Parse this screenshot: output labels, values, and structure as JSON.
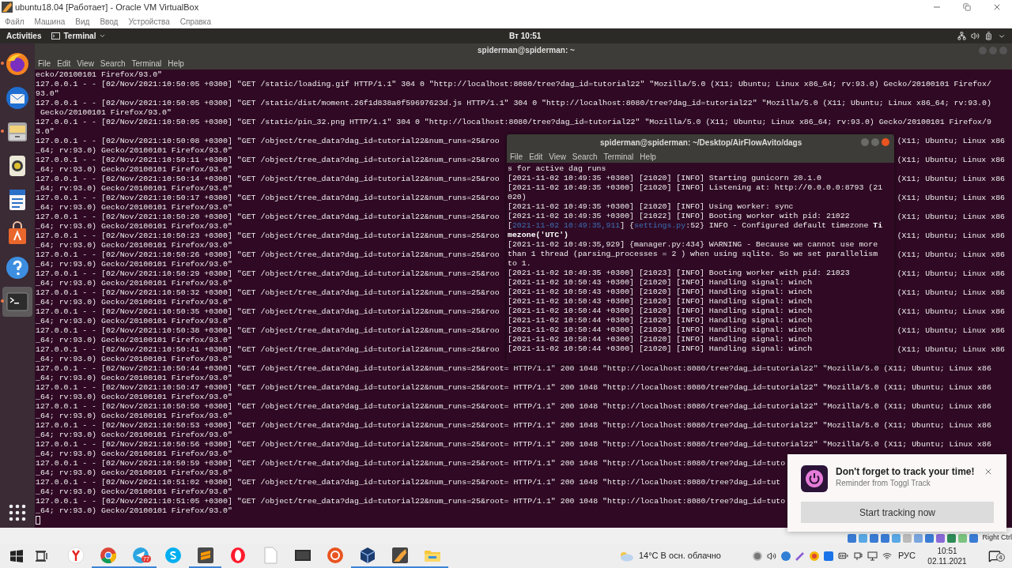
{
  "vbox_window": {
    "title": "ubuntu18.04 [Работает] - Oracle VM VirtualBox",
    "menu": [
      "Файл",
      "Машина",
      "Вид",
      "Ввод",
      "Устройства",
      "Справка"
    ]
  },
  "top_bar": {
    "activities": "Activities",
    "app_menu": "Terminal",
    "clock": "Вт 10:51"
  },
  "dock": [
    {
      "running": true,
      "selected": false
    },
    {
      "running": false,
      "selected": false
    },
    {
      "running": true,
      "selected": false
    },
    {
      "running": false,
      "selected": false
    },
    {
      "running": false,
      "selected": false
    },
    {
      "running": false,
      "selected": false
    },
    {
      "running": false,
      "selected": false
    },
    {
      "running": true,
      "selected": true
    }
  ],
  "main_terminal": {
    "title": "spiderman@spiderman: ~",
    "menu": [
      "File",
      "Edit",
      "View",
      "Search",
      "Terminal",
      "Help"
    ],
    "lines": [
      {
        "text": "ecko/20100101 Firefox/93.0\""
      },
      {
        "text": "127.0.0.1 - - [02/Nov/2021:10:50:05 +0300] \"GET /static/loading.gif HTTP/1.1\" 304 0 \"http://localhost:8080/tree?dag_id=tutorial22\" \"Mozilla/5.0 (X11; Ubuntu; Linux x86_64; rv:93.0) Gecko/20100101 Firefox/"
      },
      {
        "text": "93.0\""
      },
      {
        "text": "127.0.0.1 - - [02/Nov/2021:10:50:05 +0300] \"GET /static/dist/moment.26f1d838a0f59697623d.js HTTP/1.1\" 304 0 \"http://localhost:8080/tree?dag_id=tutorial22\" \"Mozilla/5.0 (X11; Ubuntu; Linux x86_64; rv:93.0)"
      },
      {
        "text": " Gecko/20100101 Firefox/93.0\""
      },
      {
        "text": "127.0.0.1 - - [02/Nov/2021:10:50:05 +0300] \"GET /static/pin_32.png HTTP/1.1\" 304 0 \"http://localhost:8080/tree?dag_id=tutorial22\" \"Mozilla/5.0 (X11; Ubuntu; Linux x86_64; rv:93.0) Gecko/20100101 Firefox/9"
      },
      {
        "text": "3.0\""
      },
      {
        "text": "127.0.0.1 - - [02/Nov/2021:10:50:08 +0300] \"GET /object/tree_data?dag_id=tutorial22&num_runs=25&roo",
        "text_right": "(X11; Ubuntu; Linux x86"
      },
      {
        "text": "_64; rv:93.0) Gecko/20100101 Firefox/93.0\""
      },
      {
        "text": "127.0.0.1 - - [02/Nov/2021:10:50:11 +0300] \"GET /object/tree_data?dag_id=tutorial22&num_runs=25&roo",
        "text_right": "(X11; Ubuntu; Linux x86"
      },
      {
        "text": "_64; rv:93.0) Gecko/20100101 Firefox/93.0\""
      },
      {
        "text": "127.0.0.1 - - [02/Nov/2021:10:50:14 +0300] \"GET /object/tree_data?dag_id=tutorial22&num_runs=25&roo",
        "text_right": "(X11; Ubuntu; Linux x86"
      },
      {
        "text": "_64; rv:93.0) Gecko/20100101 Firefox/93.0\""
      },
      {
        "text": "127.0.0.1 - - [02/Nov/2021:10:50:17 +0300] \"GET /object/tree_data?dag_id=tutorial22&num_runs=25&roo",
        "text_right": "(X11; Ubuntu; Linux x86"
      },
      {
        "text": "_64; rv:93.0) Gecko/20100101 Firefox/93.0\""
      },
      {
        "text": "127.0.0.1 - - [02/Nov/2021:10:50:20 +0300] \"GET /object/tree_data?dag_id=tutorial22&num_runs=25&roo",
        "text_right": "(X11; Ubuntu; Linux x86"
      },
      {
        "text": "_64; rv:93.0) Gecko/20100101 Firefox/93.0\""
      },
      {
        "text": "127.0.0.1 - - [02/Nov/2021:10:50:23 +0300] \"GET /object/tree_data?dag_id=tutorial22&num_runs=25&roo",
        "text_right": "(X11; Ubuntu; Linux x86"
      },
      {
        "text": "_64; rv:93.0) Gecko/20100101 Firefox/93.0\""
      },
      {
        "text": "127.0.0.1 - - [02/Nov/2021:10:50:26 +0300] \"GET /object/tree_data?dag_id=tutorial22&num_runs=25&roo",
        "text_right": "(X11; Ubuntu; Linux x86"
      },
      {
        "text": "_64; rv:93.0) Gecko/20100101 Firefox/93.0\""
      },
      {
        "text": "127.0.0.1 - - [02/Nov/2021:10:50:29 +0300] \"GET /object/tree_data?dag_id=tutorial22&num_runs=25&roo",
        "text_right": "(X11; Ubuntu; Linux x86"
      },
      {
        "text": "_64; rv:93.0) Gecko/20100101 Firefox/93.0\""
      },
      {
        "text": "127.0.0.1 - - [02/Nov/2021:10:50:32 +0300] \"GET /object/tree_data?dag_id=tutorial22&num_runs=25&roo",
        "text_right": "(X11; Ubuntu; Linux x86"
      },
      {
        "text": "_64; rv:93.0) Gecko/20100101 Firefox/93.0\""
      },
      {
        "text": "127.0.0.1 - - [02/Nov/2021:10:50:35 +0300] \"GET /object/tree_data?dag_id=tutorial22&num_runs=25&roo",
        "text_right": "(X11; Ubuntu; Linux x86"
      },
      {
        "text": "_64; rv:93.0) Gecko/20100101 Firefox/93.0\""
      },
      {
        "text": "127.0.0.1 - - [02/Nov/2021:10:50:38 +0300] \"GET /object/tree_data?dag_id=tutorial22&num_runs=25&roo",
        "text_right": "(X11; Ubuntu; Linux x86"
      },
      {
        "text": "_64; rv:93.0) Gecko/20100101 Firefox/93.0\""
      },
      {
        "text": "127.0.0.1 - - [02/Nov/2021:10:50:41 +0300] \"GET /object/tree_data?dag_id=tutorial22&num_runs=25&roo",
        "text_right": "(X11; Ubuntu; Linux x86"
      },
      {
        "text": "_64; rv:93.0) Gecko/20100101 Firefox/93.0\""
      },
      {
        "text": "127.0.0.1 - - [02/Nov/2021:10:50:44 +0300] \"GET /object/tree_data?dag_id=tutorial22&num_runs=25&root= HTTP/1.1\" 200 1048 \"http://localhost:8080/tree?dag_id=tutorial22\" \"Mozilla/5.0 (X11; Ubuntu; Linux x86"
      },
      {
        "text": "_64; rv:93.0) Gecko/20100101 Firefox/93.0\""
      },
      {
        "text": "127.0.0.1 - - [02/Nov/2021:10:50:47 +0300] \"GET /object/tree_data?dag_id=tutorial22&num_runs=25&root= HTTP/1.1\" 200 1048 \"http://localhost:8080/tree?dag_id=tutorial22\" \"Mozilla/5.0 (X11; Ubuntu; Linux x86"
      },
      {
        "text": "_64; rv:93.0) Gecko/20100101 Firefox/93.0\""
      },
      {
        "text": "127.0.0.1 - - [02/Nov/2021:10:50:50 +0300] \"GET /object/tree_data?dag_id=tutorial22&num_runs=25&root= HTTP/1.1\" 200 1048 \"http://localhost:8080/tree?dag_id=tutorial22\" \"Mozilla/5.0 (X11; Ubuntu; Linux x86"
      },
      {
        "text": "_64; rv:93.0) Gecko/20100101 Firefox/93.0\""
      },
      {
        "text": "127.0.0.1 - - [02/Nov/2021:10:50:53 +0300] \"GET /object/tree_data?dag_id=tutorial22&num_runs=25&root= HTTP/1.1\" 200 1048 \"http://localhost:8080/tree?dag_id=tutorial22\" \"Mozilla/5.0 (X11; Ubuntu; Linux x86"
      },
      {
        "text": "_64; rv:93.0) Gecko/20100101 Firefox/93.0\""
      },
      {
        "text": "127.0.0.1 - - [02/Nov/2021:10:50:56 +0300] \"GET /object/tree_data?dag_id=tutorial22&num_runs=25&root= HTTP/1.1\" 200 1048 \"http://localhost:8080/tree?dag_id=tutorial22\" \"Mozilla/5.0 (X11; Ubuntu; Linux x86"
      },
      {
        "text": "_64; rv:93.0) Gecko/20100101 Firefox/93.0\""
      },
      {
        "text": "127.0.0.1 - - [02/Nov/2021:10:50:59 +0300] \"GET /object/tree_data?dag_id=tutorial22&num_runs=25&root= HTTP/1.1\" 200 1048 \"http://localhost:8080/tree?dag_id=tuto"
      },
      {
        "text": "_64; rv:93.0) Gecko/20100101 Firefox/93.0\""
      },
      {
        "text": "127.0.0.1 - - [02/Nov/2021:10:51:02 +0300] \"GET /object/tree_data?dag_id=tutorial22&num_runs=25&root= HTTP/1.1\" 200 1048 \"http://localhost:8080/tree?dag_id=tut"
      },
      {
        "text": "_64; rv:93.0) Gecko/20100101 Firefox/93.0\""
      },
      {
        "text": "127.0.0.1 - - [02/Nov/2021:10:51:05 +0300] \"GET /object/tree_data?dag_id=tutorial22&num_runs=25&root= HTTP/1.1\" 200 1048 \"http://localhost:8080/tree?dag_id=tuto"
      },
      {
        "text": "_64; rv:93.0) Gecko/20100101 Firefox/93.0\""
      }
    ]
  },
  "second_terminal": {
    "title": "spiderman@spiderman: ~/Desktop/AirFlowAvito/dags",
    "menu": [
      "File",
      "Edit",
      "View",
      "Search",
      "Terminal",
      "Help"
    ],
    "lines": [
      {
        "text": "s for active dag runs"
      },
      {
        "text": "[2021-11-02 10:49:35 +0300] [21020] [INFO] Starting gunicorn 20.1.0"
      },
      {
        "text": "[2021-11-02 10:49:35 +0300] [21020] [INFO] Listening at: http://0.0.0.0:8793 (21"
      },
      {
        "text": "020)"
      },
      {
        "text": "[2021-11-02 10:49:35 +0300] [21020] [INFO] Using worker: sync"
      },
      {
        "text": "[2021-11-02 10:49:35 +0300] [21022] [INFO] Booting worker with pid: 21022"
      },
      {
        "segments": [
          {
            "kind": "plain",
            "text": "["
          },
          {
            "kind": "link",
            "text": "2021-11-02 10:49:35,911"
          },
          {
            "kind": "plain",
            "text": "] {"
          },
          {
            "kind": "link",
            "text": "settings.py"
          },
          {
            "kind": "plain",
            "text": ":52} INFO - Configured default timezone "
          },
          {
            "kind": "bold",
            "text": "Ti"
          }
        ]
      },
      {
        "segments": [
          {
            "kind": "bold",
            "text": "mezone('UTC')"
          }
        ]
      },
      {
        "text": "[2021-11-02 10:49:35,929] {manager.py:434} WARNING - Because we cannot use more"
      },
      {
        "text": "than 1 thread (parsing_processes = 2 ) when using sqlite. So we set parallelism"
      },
      {
        "text": "to 1."
      },
      {
        "text": "[2021-11-02 10:49:35 +0300] [21023] [INFO] Booting worker with pid: 21023"
      },
      {
        "text": "[2021-11-02 10:50:43 +0300] [21020] [INFO] Handling signal: winch"
      },
      {
        "text": "[2021-11-02 10:50:43 +0300] [21020] [INFO] Handling signal: winch"
      },
      {
        "text": "[2021-11-02 10:50:43 +0300] [21020] [INFO] Handling signal: winch"
      },
      {
        "text": "[2021-11-02 10:50:44 +0300] [21020] [INFO] Handling signal: winch"
      },
      {
        "text": "[2021-11-02 10:50:44 +0300] [21020] [INFO] Handling signal: winch"
      },
      {
        "text": "[2021-11-02 10:50:44 +0300] [21020] [INFO] Handling signal: winch"
      },
      {
        "text": "[2021-11-02 10:50:44 +0300] [21020] [INFO] Handling signal: winch"
      },
      {
        "text": "[2021-11-02 10:50:44 +0300] [21020] [INFO] Handling signal: winch"
      }
    ]
  },
  "notification": {
    "title": "Don't forget to track your time!",
    "subtitle": "Reminder from Toggl Track",
    "button": "Start tracking now"
  },
  "vm_status": {
    "host_key": "Right Ctrl"
  },
  "taskbar": {
    "apps": [
      {
        "active": false
      },
      {
        "active": true
      },
      {
        "active": true,
        "badge": "77"
      },
      {
        "active": false
      },
      {
        "active": true
      },
      {
        "active": false
      },
      {
        "active": false
      },
      {
        "active": false
      },
      {
        "active": false
      },
      {
        "active": true
      },
      {
        "active": true
      },
      {
        "active": true
      }
    ],
    "weather": "14°C В осн. облачно",
    "language": "РУС",
    "time": "10:51",
    "date": "02.11.2021",
    "notifications": "4"
  }
}
